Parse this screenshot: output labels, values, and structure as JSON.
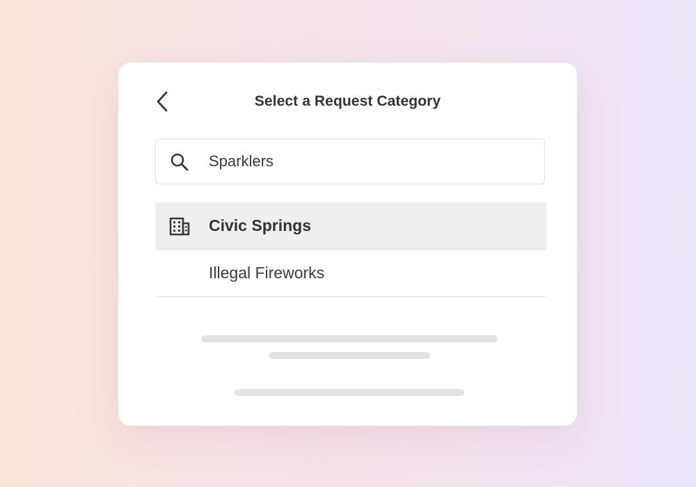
{
  "header": {
    "title": "Select a Request Category",
    "back_icon": "chevron-left-icon"
  },
  "search": {
    "icon": "search-icon",
    "value": "Sparklers"
  },
  "results": [
    {
      "label": "Civic Springs",
      "icon": "building-icon",
      "highlighted": true
    },
    {
      "label": "Illegal Fireworks",
      "icon": null,
      "highlighted": false
    }
  ],
  "colors": {
    "card_background": "#ffffff",
    "highlight_row": "#efefef",
    "text_primary": "#333333",
    "skeleton": "#e3e3e3"
  }
}
